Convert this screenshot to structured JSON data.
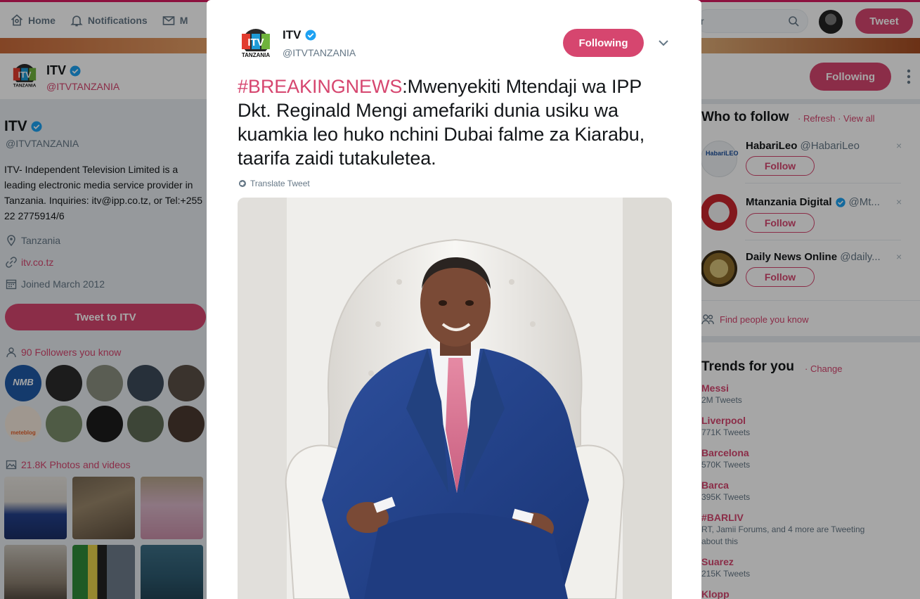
{
  "nav": {
    "home": "Home",
    "notifications": "Notifications",
    "messages": "M",
    "search_placeholder": "r",
    "tweet": "Tweet"
  },
  "profile": {
    "name": "ITV",
    "handle": "@ITVTANZANIA",
    "following_label": "Following",
    "bio": "ITV- Independent Television Limited is a leading electronic media service provider in Tanzania. Inquiries: itv@ipp.co.tz, or Tel:+255 22 2775914/6",
    "location": "Tanzania",
    "website": "itv.co.tz",
    "joined": "Joined March 2012",
    "tweet_to": "Tweet to ITV",
    "followers_you_know": "90 Followers you know",
    "photos_videos": "21.8K Photos and videos",
    "logo_text": "ITV",
    "logo_subtext": "TANZANIA"
  },
  "followers_known": [
    {
      "label": "NMB",
      "color": "#1f5aa6"
    },
    {
      "label": "",
      "color": "#2b2b2b"
    },
    {
      "label": "",
      "color": "#8a8f80"
    },
    {
      "label": "",
      "color": "#3c4a5a"
    },
    {
      "label": "",
      "color": "#5a4f46"
    },
    {
      "label": "meteblog",
      "color": "#f4e9dc"
    },
    {
      "label": "",
      "color": "#7a8c6a"
    },
    {
      "label": "",
      "color": "#1d1d1d"
    },
    {
      "label": "",
      "color": "#5f6b55"
    },
    {
      "label": "",
      "color": "#4a3a30"
    }
  ],
  "who_to_follow": {
    "title": "Who to follow",
    "links": "· Refresh · View all",
    "accounts": [
      {
        "name": "HabariLeo",
        "handle": "@HabariLeo",
        "follow": "Follow",
        "verified": false,
        "color": "#e9eef2"
      },
      {
        "name": "Mtanzania Digital",
        "handle": "@Mt...",
        "follow": "Follow",
        "verified": true,
        "color": "#c8262d"
      },
      {
        "name": "Daily News Online",
        "handle": "@daily...",
        "follow": "Follow",
        "verified": false,
        "color": "#b08a3e"
      }
    ],
    "dismiss": "×",
    "find_people": "Find people you know"
  },
  "trends": {
    "title": "Trends for you",
    "change": "· Change",
    "items": [
      {
        "name": "Messi",
        "count": "2M Tweets"
      },
      {
        "name": "Liverpool",
        "count": "771K Tweets"
      },
      {
        "name": "Barcelona",
        "count": "570K Tweets"
      },
      {
        "name": "Barca",
        "count": "395K Tweets"
      },
      {
        "name": "#BARLIV",
        "count": "RT, Jamii Forums, and 4 more are Tweeting about this"
      },
      {
        "name": "Suarez",
        "count": "215K Tweets"
      },
      {
        "name": "Klopp",
        "count": ""
      }
    ]
  },
  "modal": {
    "name": "ITV",
    "handle": "@ITVTANZANIA",
    "following_label": "Following",
    "hashtag": "#BREAKINGNEWS",
    "text": ":Mwenyekiti Mtendaji wa IPP Dkt. Reginald Mengi amefariki dunia usiku wa kuamkia leo huko nchini Dubai falme za Kiarabu, taarifa zaidi tutakuletea.",
    "translate": "Translate Tweet"
  },
  "colors": {
    "accent": "#d6466f",
    "verified": "#1da1f2"
  }
}
